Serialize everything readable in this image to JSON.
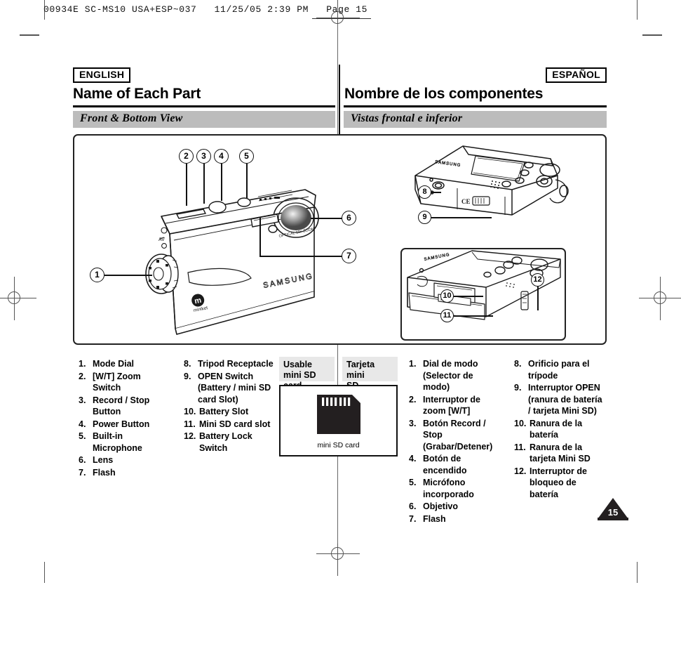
{
  "scan_header": {
    "text": "00934E SC-MS10 USA+ESP~037   11/25/05 2:39 PM   Page 15"
  },
  "english": {
    "lang_label": "ENGLISH",
    "title": "Name of Each Part",
    "section": "Front & Bottom View",
    "parts": [
      {
        "num": "1.",
        "label": "Mode Dial"
      },
      {
        "num": "2.",
        "label": "[W/T] Zoom Switch"
      },
      {
        "num": "3.",
        "label": "Record / Stop Button"
      },
      {
        "num": "4.",
        "label": "Power Button"
      },
      {
        "num": "5.",
        "label": "Built-in Microphone"
      },
      {
        "num": "6.",
        "label": "Lens"
      },
      {
        "num": "7.",
        "label": "Flash"
      },
      {
        "num": "8.",
        "label": "Tripod Receptacle"
      },
      {
        "num": "9.",
        "label": "OPEN Switch (Battery / mini SD card Slot)"
      },
      {
        "num": "10.",
        "label": "Battery Slot"
      },
      {
        "num": "11.",
        "label": "Mini SD card slot"
      },
      {
        "num": "12.",
        "label": "Battery Lock Switch"
      }
    ]
  },
  "spanish": {
    "lang_label": "ESPAÑOL",
    "title": "Nombre de los componentes",
    "section": "Vistas frontal e inferior",
    "parts": [
      {
        "num": "1.",
        "label": "Dial de modo (Selector de modo)"
      },
      {
        "num": "2.",
        "label": "Interruptor de zoom [W/T]"
      },
      {
        "num": "3.",
        "label": "Botón Record / Stop (Grabar/Detener)"
      },
      {
        "num": "4.",
        "label": "Botón de encendido"
      },
      {
        "num": "5.",
        "label": "Micrófono incorporado"
      },
      {
        "num": "6.",
        "label": "Objetivo"
      },
      {
        "num": "7.",
        "label": "Flash"
      },
      {
        "num": "8.",
        "label": "Orificio para el trípode"
      },
      {
        "num": "9.",
        "label": "Interruptor OPEN (ranura de batería / tarjeta Mini SD)"
      },
      {
        "num": "10.",
        "label": "Ranura de la batería"
      },
      {
        "num": "11.",
        "label": "Ranura de la tarjeta Mini SD"
      },
      {
        "num": "12.",
        "label": "Interruptor de bloqueo de batería"
      }
    ]
  },
  "sd_callout": {
    "tab_en": "Usable\nmini SD card",
    "tab_en_line1": "Usable",
    "tab_en_line2": "mini SD card",
    "tab_es_line1": "Tarjeta mini",
    "tab_es_line2": "SD utilizable",
    "caption": "mini SD card"
  },
  "illustration": {
    "brand": "SAMSUNG",
    "sub_brand": "miniket",
    "lens_text": "OPTICAL 10x ZOOM",
    "ce_mark": "CE",
    "callouts": [
      "1",
      "2",
      "3",
      "4",
      "5",
      "6",
      "7",
      "8",
      "9",
      "10",
      "11",
      "12"
    ]
  },
  "page_number": "15",
  "colors": {
    "band_gray": "#bcbcbc",
    "tab_gray": "#e8e8e8",
    "ink": "#000000",
    "badge": "#231f20"
  }
}
